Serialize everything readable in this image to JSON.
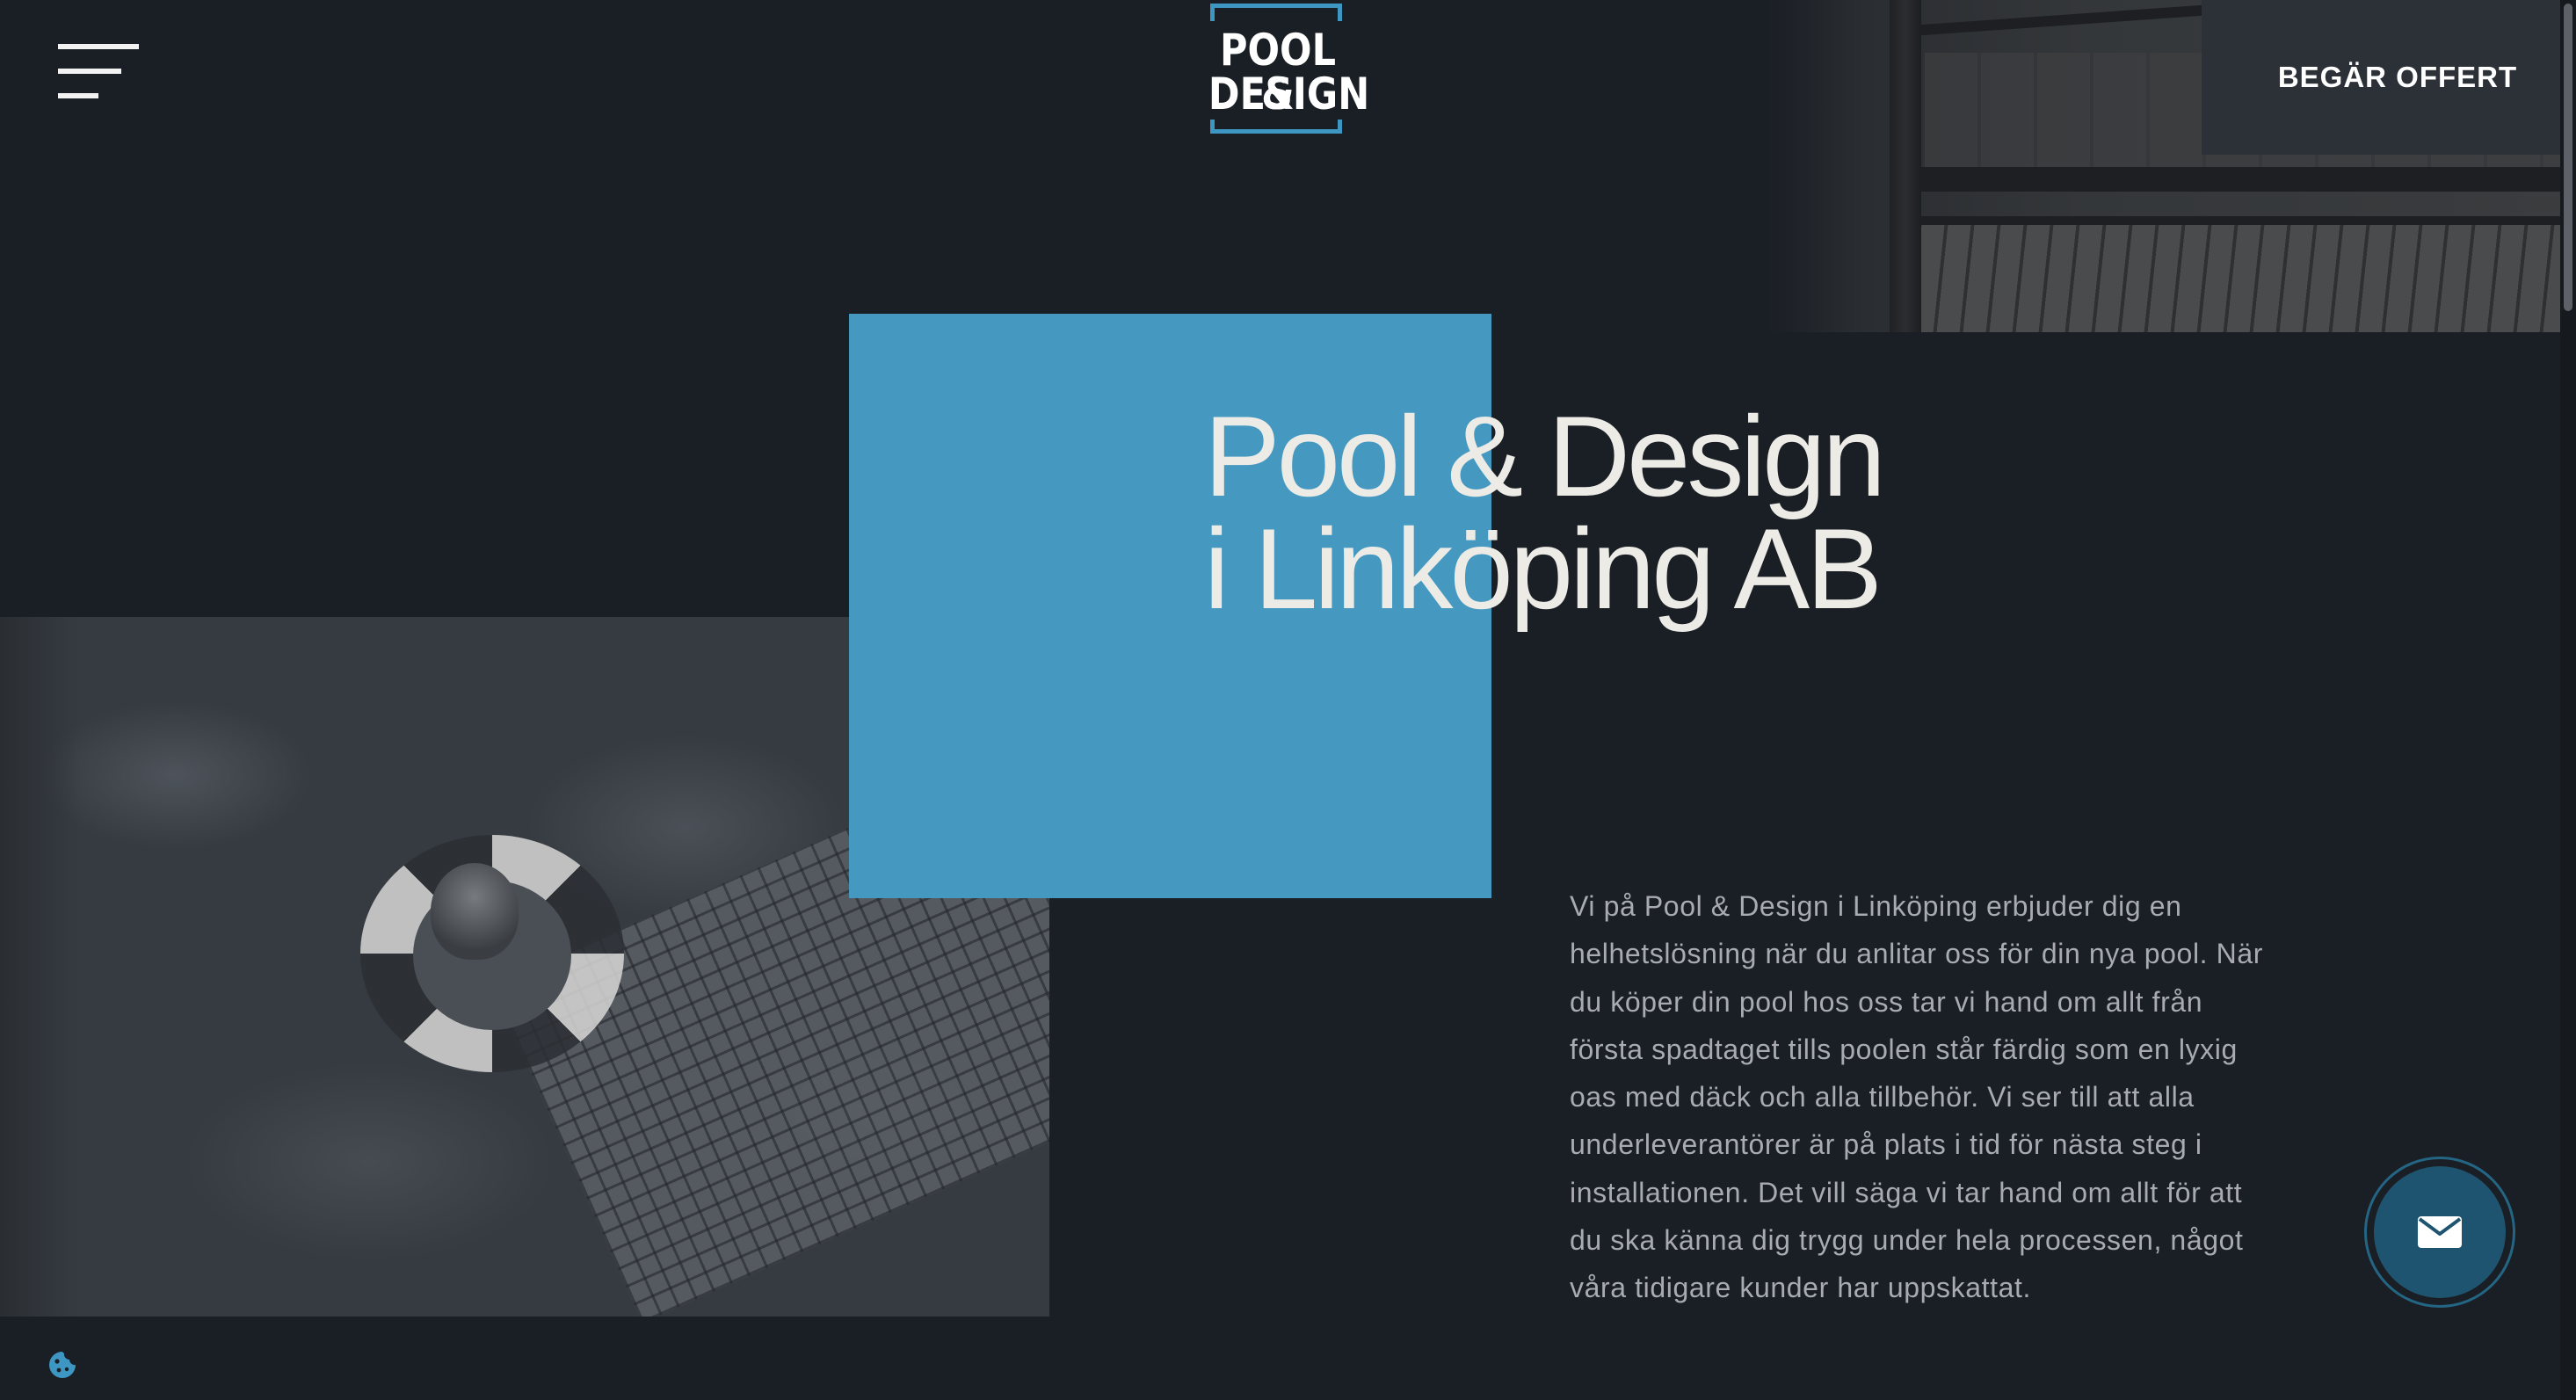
{
  "header": {
    "menu_icon": "hamburger-menu-icon",
    "logo": {
      "line1": "POOL &",
      "line2": "DESIGN",
      "frame_color": "#3d97c2"
    },
    "quote_button_label": "BEGÄR OFFERT"
  },
  "hero": {
    "title_line1": "Pool & Design",
    "title_line2": "i Linköping AB",
    "accent_color": "#4599c0",
    "intro": "Vi på Pool & Design i Linköping erbjuder dig en helhetslösning när du anlitar oss för din nya pool. När du köper din pool hos oss tar vi hand om allt från första spadtaget tills poolen står färdig som en lyxig oas med däck och alla tillbehör. Vi ser till att alla underleverantörer är på plats i tid för nästa steg i installationen. Det vill säga vi tar hand om allt för att du ska känna dig trygg under hela processen, något våra tidigare kunder har uppskattat."
  },
  "floating": {
    "mail_icon": "envelope-icon",
    "cookie_icon": "cookie-icon"
  },
  "colors": {
    "background": "#1a1e25",
    "quote_button_bg": "#2c3037",
    "mail_button_bg": "#1f5470"
  }
}
